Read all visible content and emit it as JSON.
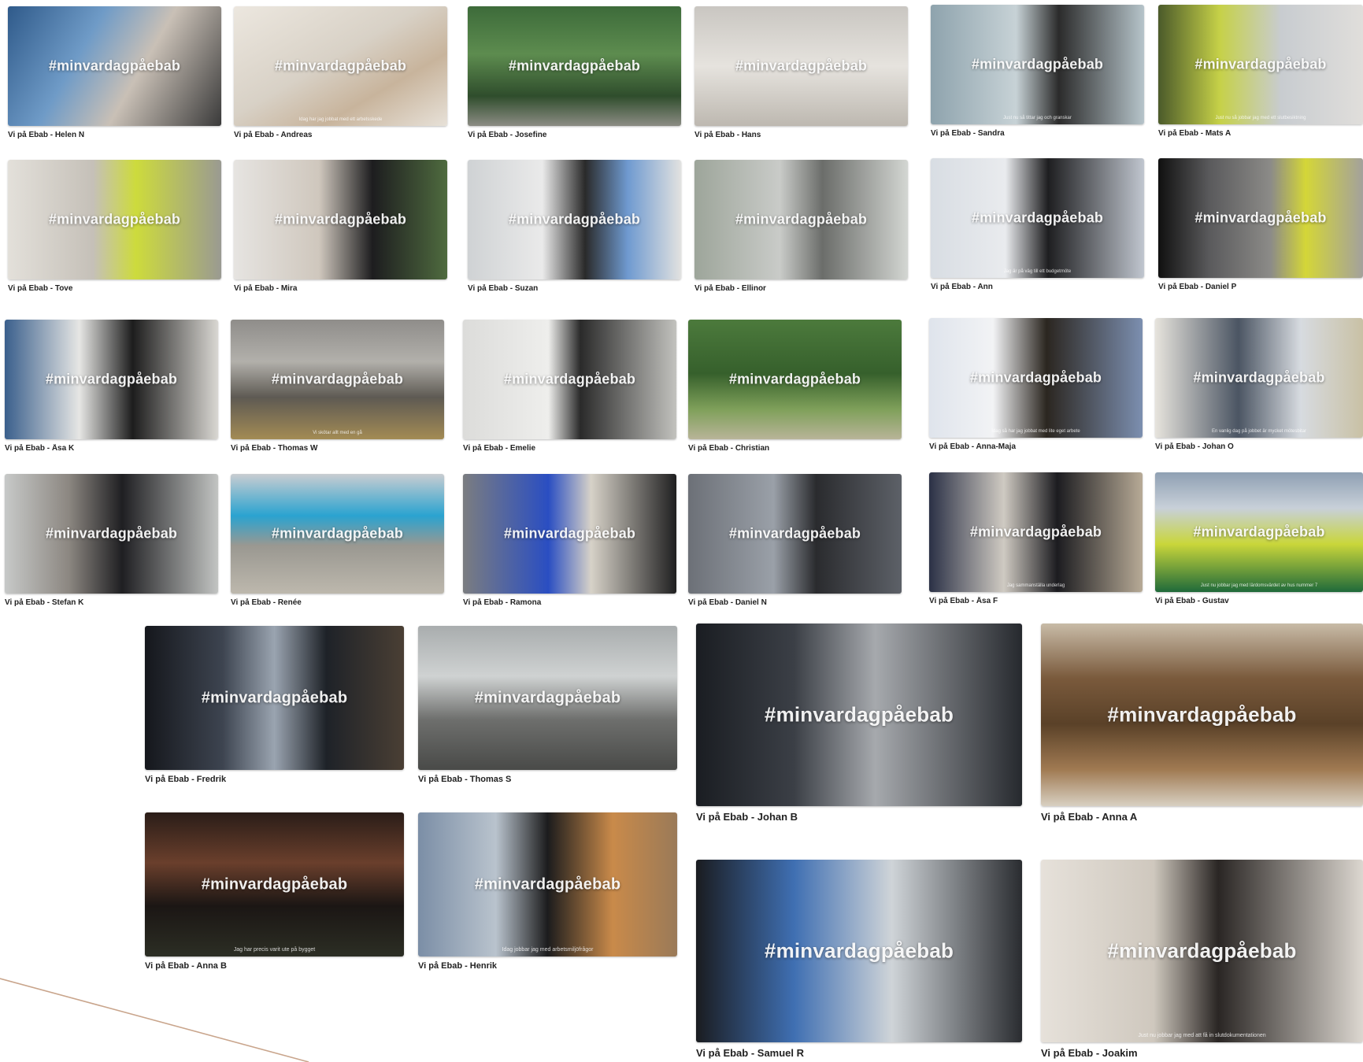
{
  "hashtag": "#minvardagpåebab",
  "accent_line_color": "#c9a58c",
  "videos": [
    {
      "title": "Vi på Ebab - Helen N",
      "subtitle": "",
      "bg": "linear-gradient(120deg,#2f5a8a 0%,#6f9bc7 35%,#c9c0b6 60%,#3a3a3a 100%)"
    },
    {
      "title": "Vi på Ebab - Andreas",
      "subtitle": "Idag har jag jobbat med ett arbetsskede",
      "bg": "linear-gradient(150deg,#ece7df 0%,#d8d1c6 45%,#c8b49c 70%,#e7e1d8 100%)"
    },
    {
      "title": "Vi på Ebab - Josefine",
      "subtitle": "",
      "bg": "linear-gradient(180deg,#3d6b3a 0%,#5d8c4f 40%,#2f4d2c 75%,#8c8c84 100%)"
    },
    {
      "title": "Vi på Ebab - Hans",
      "subtitle": "",
      "bg": "linear-gradient(180deg,#c9c6c1 0%,#e6e3de 50%,#bdb8b0 100%)"
    },
    {
      "title": "Vi på Ebab - Sandra",
      "subtitle": "Just nu så tittar jag och granskar",
      "bg": "linear-gradient(90deg,#8ea3ad 0%,#c7d2d6 40%,#2b2b2b 60%,#b6c4ca 100%)"
    },
    {
      "title": "Vi på Ebab - Mats A",
      "subtitle": "Just nu så jobbar jag med ett slutbesiktning",
      "bg": "linear-gradient(90deg,#4b5a2a 0%,#c6d148 30%,#c8ccd0 60%,#e0dedb 100%)"
    },
    {
      "title": "Vi på Ebab - Tove",
      "subtitle": "",
      "bg": "linear-gradient(90deg,#e3e0da 0%,#c5c0b8 40%,#cddb3c 60%,#9a9a92 100%)"
    },
    {
      "title": "Vi på Ebab - Mira",
      "subtitle": "",
      "bg": "linear-gradient(90deg,#e6e4e1 0%,#cfc7bd 40%,#1d1d1f 65%,#4f6b3f 100%)"
    },
    {
      "title": "Vi på Ebab - Suzan",
      "subtitle": "",
      "bg": "linear-gradient(90deg,#cfd2d4 0%,#eaeaea 35%,#2a2a2a 55%,#6f9ad0 75%,#e2e2e0 100%)"
    },
    {
      "title": "Vi på Ebab - Ellinor",
      "subtitle": "",
      "bg": "linear-gradient(90deg,#9da59a 0%,#c9cbc8 40%,#6b6d6a 60%,#d3d6d2 100%)"
    },
    {
      "title": "Vi på Ebab - Ann",
      "subtitle": "Jag är på väg till ett budgetmöte",
      "bg": "linear-gradient(90deg,#d8dde3 0%,#e9ebee 35%,#1e1e20 55%,#c0c6cf 100%)"
    },
    {
      "title": "Vi på Ebab - Daniel P",
      "subtitle": "",
      "bg": "linear-gradient(90deg,#101010 0%,#5a5a5c 25%,#8c8b88 55%,#d4d638 72%,#a3a19c 100%)"
    },
    {
      "title": "Vi på Ebab - Åsa K",
      "subtitle": "",
      "bg": "linear-gradient(90deg,#3a5f8c 0%,#e6e6e4 35%,#1d1d1d 60%,#d9d7d2 100%)"
    },
    {
      "title": "Vi på Ebab - Thomas W",
      "subtitle": "Vi skötar allt med en gå",
      "bg": "linear-gradient(180deg,#8f8d8a 0%,#b2b0ab 35%,#5e5a53 65%,#a38b54 100%)"
    },
    {
      "title": "Vi på Ebab - Emelie",
      "subtitle": "",
      "bg": "linear-gradient(90deg,#dcdcda 0%,#eeeeec 40%,#2a2a2a 55%,#c2c2be 100%)"
    },
    {
      "title": "Vi på Ebab - Christian",
      "subtitle": "",
      "bg": "linear-gradient(180deg,#4c7a3c 0%,#36602c 45%,#7fa05a 75%,#b8b498 100%)"
    },
    {
      "title": "Vi på Ebab - Anna-Maja",
      "subtitle": "Idag så har jag jobbat med lite eget arbete",
      "bg": "linear-gradient(90deg,#dfe4ec 0%,#f2f3f5 30%,#2b2620 55%,#7c8fb0 100%)"
    },
    {
      "title": "Vi på Ebab - Johan Ö",
      "subtitle": "En vanlig dag på jobbet är mycket mötesbitar",
      "bg": "linear-gradient(90deg,#e7e4dd 0%,#4b5563 40%,#d7dbe0 70%,#c9c1a5 100%)"
    },
    {
      "title": "Vi på Ebab - Stefan K",
      "subtitle": "",
      "bg": "linear-gradient(90deg,#c7c9c8 0%,#8c8781 30%,#1f1f22 55%,#c2c4c2 100%)"
    },
    {
      "title": "Vi på Ebab - Renée",
      "subtitle": "",
      "bg": "linear-gradient(180deg,#c9cdd1 0%,#2aa3d0 35%,#9a9891 60%,#bdb8ad 100%)"
    },
    {
      "title": "Vi på Ebab - Ramona",
      "subtitle": "",
      "bg": "linear-gradient(90deg,#7b7d80 0%,#2a4ec2 40%,#d7d2c8 60%,#1f1f20 100%)"
    },
    {
      "title": "Vi på Ebab - Daniel N",
      "subtitle": "",
      "bg": "linear-gradient(90deg,#6c7077 0%,#9aa0a8 40%,#2a2b2e 60%,#5d6168 100%)"
    },
    {
      "title": "Vi på Ebab - Åsa F",
      "subtitle": "Jag sammanställa underlag",
      "bg": "linear-gradient(90deg,#2b3146 0%,#cfcac2 35%,#1c1c20 60%,#b7aa96 100%)"
    },
    {
      "title": "Vi på Ebab - Gustav",
      "subtitle": "Just nu jobbar jag med lärdomsvärdet av hus nummer 7",
      "bg": "linear-gradient(180deg,#8fa0b3 0%,#c8d0d9 30%,#c9d63a 60%,#1f6a3a 100%)"
    },
    {
      "title": "Vi på Ebab - Fredrik",
      "subtitle": "",
      "bg": "linear-gradient(90deg,#15171c 0%,#3d4450 30%,#9aa4b0 50%,#1e2228 70%,#4a3f34 100%)"
    },
    {
      "title": "Vi på Ebab - Thomas S",
      "subtitle": "",
      "bg": "linear-gradient(180deg,#a9adae 0%,#cfd2d2 35%,#6e6f6d 65%,#494a48 100%)"
    },
    {
      "title": "Vi på Ebab - Johan B",
      "subtitle": "",
      "bg": "linear-gradient(90deg,#1a1d22 0%,#3b3f46 30%,#a6a9ad 55%,#26292e 100%)"
    },
    {
      "title": "Vi på Ebab - Anna A",
      "subtitle": "",
      "bg": "linear-gradient(180deg,#c8bba7 0%,#7a5a3c 30%,#5a4128 55%,#a07a52 80%,#d8d0c2 100%)"
    },
    {
      "title": "Vi på Ebab - Anna B",
      "subtitle": "Jag har precis varit ute på bygget",
      "bg": "linear-gradient(180deg,#2a1d18 0%,#6a3f2c 35%,#1b1614 65%,#2c2e24 100%)"
    },
    {
      "title": "Vi på Ebab - Henrik",
      "subtitle": "Idag jobbar jag med arbetsmiljöfrågor",
      "bg": "linear-gradient(90deg,#7b8ea6 0%,#b9c3cd 30%,#1c1c1d 50%,#c98a4a 75%,#9a7a58 100%)"
    },
    {
      "title": "Vi på Ebab - Samuel R",
      "subtitle": "",
      "bg": "linear-gradient(90deg,#1a1c20 0%,#3f6fb2 30%,#cfd4d8 60%,#2a2c30 100%)"
    },
    {
      "title": "Vi på Ebab - Joakim",
      "subtitle": "Just nu jobbar jag med att få in slutdokumentationen",
      "bg": "linear-gradient(90deg,#e6e1da 0%,#cfc8be 35%,#2a2624 55%,#dcd7d0 100%)"
    }
  ]
}
